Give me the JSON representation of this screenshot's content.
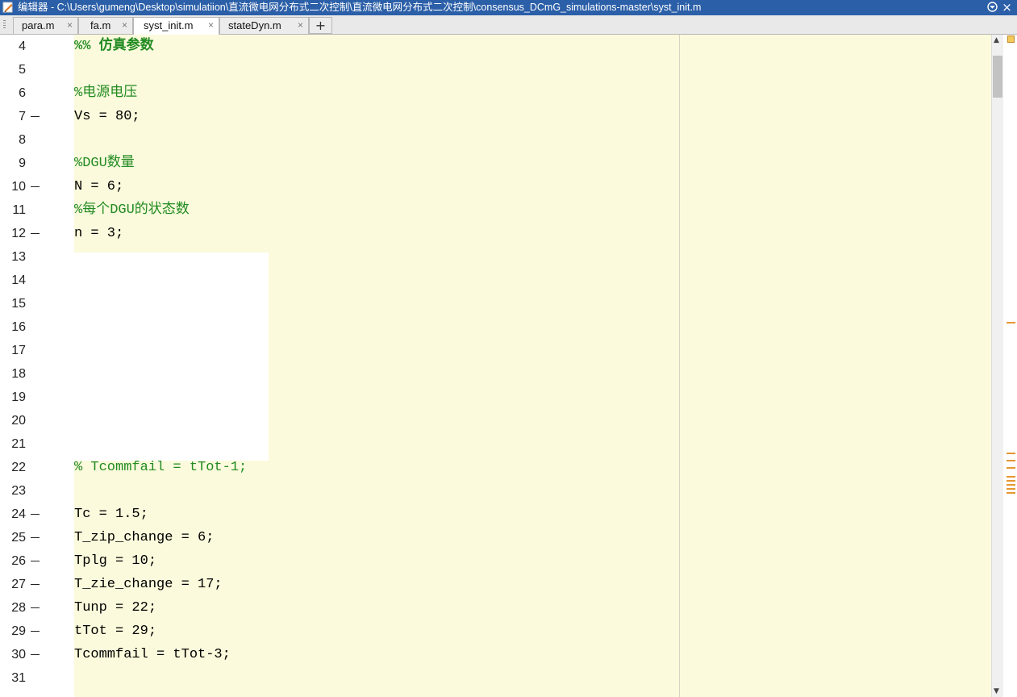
{
  "window": {
    "title": "编辑器 - C:\\Users\\gumeng\\Desktop\\simulatiion\\直流微电网分布式二次控制\\直流微电网分布式二次控制\\consensus_DCmG_simulations-master\\syst_init.m",
    "menu_icon": "chevron-down-circle-icon",
    "close_label": "×"
  },
  "tabs": [
    {
      "label": "para.m",
      "close": "×",
      "active": false
    },
    {
      "label": "fa.m",
      "close": "×",
      "active": false
    },
    {
      "label": "syst_init.m",
      "close": "×",
      "active": true
    },
    {
      "label": "stateDyn.m",
      "close": "×",
      "active": false
    }
  ],
  "new_tab_label": "+",
  "editor": {
    "lines": [
      {
        "num": "4",
        "text": "%% 仿真参数",
        "kind": "section",
        "exec": false
      },
      {
        "num": "5",
        "text": "",
        "kind": "code",
        "exec": false
      },
      {
        "num": "6",
        "text": "%电源电压",
        "kind": "comment",
        "exec": false
      },
      {
        "num": "7",
        "text": "Vs = 80;",
        "kind": "code",
        "exec": true
      },
      {
        "num": "8",
        "text": "",
        "kind": "code",
        "exec": false
      },
      {
        "num": "9",
        "text": "%DGU数量",
        "kind": "comment",
        "exec": false
      },
      {
        "num": "10",
        "text": "N = 6;",
        "kind": "code",
        "exec": true
      },
      {
        "num": "11",
        "text": "%每个DGU的状态数",
        "kind": "comment",
        "exec": false
      },
      {
        "num": "12",
        "text": "n = 3;",
        "kind": "code",
        "exec": true
      },
      {
        "num": "13",
        "text": "",
        "kind": "code",
        "exec": false
      },
      {
        "num": "14",
        "text": "",
        "kind": "code",
        "exec": false
      },
      {
        "num": "15",
        "text": "",
        "kind": "code",
        "exec": false
      },
      {
        "num": "16",
        "text": "",
        "kind": "code",
        "exec": false
      },
      {
        "num": "17",
        "text": "",
        "kind": "code",
        "exec": false
      },
      {
        "num": "18",
        "text": "",
        "kind": "code",
        "exec": false
      },
      {
        "num": "19",
        "text": "",
        "kind": "code",
        "exec": false
      },
      {
        "num": "20",
        "text": "",
        "kind": "code",
        "exec": false
      },
      {
        "num": "21",
        "text": "",
        "kind": "code",
        "exec": false
      },
      {
        "num": "22",
        "text": "% Tcommfail = tTot-1;",
        "kind": "comment",
        "exec": false
      },
      {
        "num": "23",
        "text": "",
        "kind": "code",
        "exec": false
      },
      {
        "num": "24",
        "text": "Tc = 1.5;",
        "kind": "code",
        "exec": true
      },
      {
        "num": "25",
        "text": "T_zip_change = 6;",
        "kind": "code",
        "exec": true
      },
      {
        "num": "26",
        "text": "Tplg = 10;",
        "kind": "code",
        "exec": true
      },
      {
        "num": "27",
        "text": "T_zie_change = 17;",
        "kind": "code",
        "exec": true
      },
      {
        "num": "28",
        "text": "Tunp = 22;",
        "kind": "code",
        "exec": true
      },
      {
        "num": "29",
        "text": "tTot = 29;",
        "kind": "code",
        "exec": true
      },
      {
        "num": "30",
        "text": "Tcommfail = tTot-3;",
        "kind": "code",
        "exec": true
      },
      {
        "num": "31",
        "text": "",
        "kind": "code",
        "exec": false
      }
    ]
  },
  "scrollbar": {
    "up_arrow": "▲",
    "down_arrow": "▼"
  },
  "colors": {
    "title_bar": "#2b5fa8",
    "code_background": "#fbfadc",
    "comment": "#228b22",
    "marker": "#e8962e"
  }
}
